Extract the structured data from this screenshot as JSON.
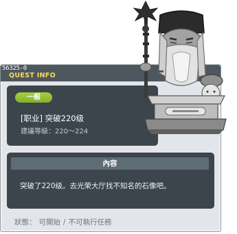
{
  "window": {
    "quest_id": "56325-0",
    "title": "QUEST INFO"
  },
  "quest": {
    "category": "一般",
    "name": "[职业] 突破220级",
    "level_requirement": "建議等級：220～224"
  },
  "content": {
    "header": "內容",
    "text": "突破了220级。去光荣大厅找不知名的石像吧。"
  },
  "status": {
    "label": "狀態：",
    "availability": "可開始",
    "separator": "/",
    "action": "不可執行任務"
  },
  "npc": {
    "icon": "stone-statue-npc"
  },
  "colors": {
    "title_yellow": "#f6de5a",
    "badge_green": "#95c137",
    "panel_dark": "#3c454c",
    "window_bg": "#e2e5e9"
  }
}
